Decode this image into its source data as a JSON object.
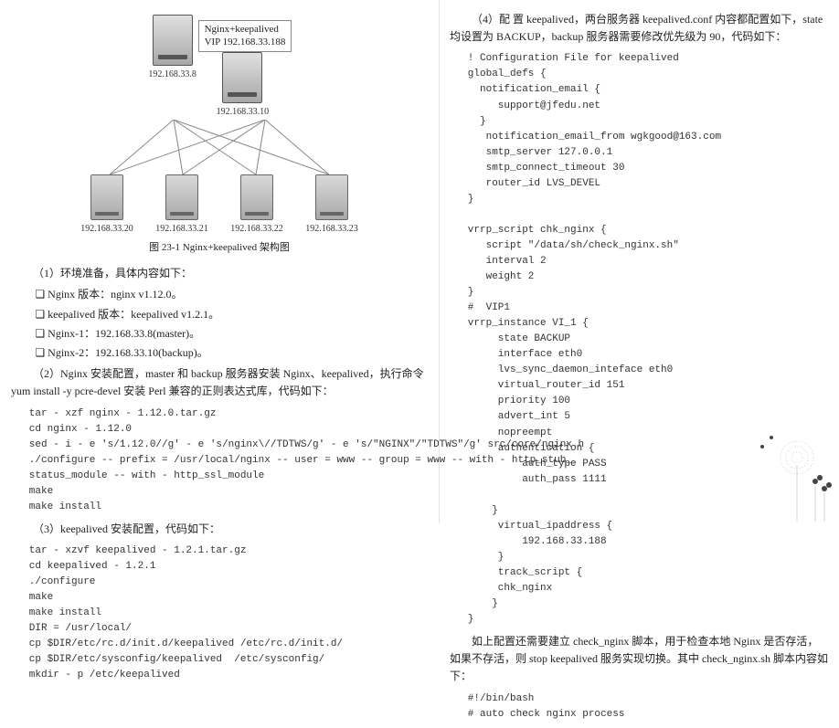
{
  "diagram": {
    "top_label_line1": "Nginx+keepalived",
    "top_label_line2": "VIP 192.168.33.188",
    "top_ip_left": "192.168.33.8",
    "top_ip_right": "192.168.33.10",
    "bottom_ips": [
      "192.168.33.20",
      "192.168.33.21",
      "192.168.33.22",
      "192.168.33.23"
    ],
    "caption": "图 23-1  Nginx+keepalived 架构图"
  },
  "left": {
    "p1": "（1）环境准备，具体内容如下：",
    "b1": "Nginx 版本：nginx v1.12.0。",
    "b2": "keepalived 版本：keepalived v1.2.1。",
    "b3": "Nginx-1：192.168.33.8(master)。",
    "b4": "Nginx-2：192.168.33.10(backup)。",
    "p2": "（2）Nginx 安装配置，master 和 backup 服务器安装 Nginx、keepalived，执行命令 yum install -y pcre-devel 安装 Perl 兼容的正则表达式库，代码如下：",
    "code1": "tar - xzf nginx - 1.12.0.tar.gz\ncd nginx - 1.12.0\nsed - i - e 's/1.12.0//g' - e 's/nginx\\//TDTWS/g' - e 's/\"NGINX\"/\"TDTWS\"/g' src/core/nginx.h\n./configure -- prefix = /usr/local/nginx -- user = www -- group = www -- with - http_stub_\nstatus_module -- with - http_ssl_module\nmake\nmake install",
    "p3": "（3）keepalived 安装配置，代码如下：",
    "code2": "tar - xzvf keepalived - 1.2.1.tar.gz\ncd keepalived - 1.2.1\n./configure\nmake\nmake install\nDIR = /usr/local/\ncp $DIR/etc/rc.d/init.d/keepalived /etc/rc.d/init.d/\ncp $DIR/etc/sysconfig/keepalived  /etc/sysconfig/\nmkdir - p /etc/keepalived"
  },
  "right": {
    "p1": "（4）配 置 keepalived，两台服务器 keepalived.conf 内容都配置如下，state 均设置为 BACKUP，backup 服务器需要修改优先级为 90，代码如下：",
    "code1": "! Configuration File for keepalived\nglobal_defs {\n  notification_email {\n     support@jfedu.net\n  }\n   notification_email_from wgkgood@163.com\n   smtp_server 127.0.0.1\n   smtp_connect_timeout 30\n   router_id LVS_DEVEL\n}\n\nvrrp_script chk_nginx {\n   script \"/data/sh/check_nginx.sh\"\n   interval 2\n   weight 2\n}\n#  VIP1\nvrrp_instance VI_1 {\n     state BACKUP\n     interface eth0\n     lvs_sync_daemon_inteface eth0\n     virtual_router_id 151\n     priority 100\n     advert_int 5\n     nopreempt\n     authentication {\n         auth_type PASS\n         auth_pass 1111\n\n    }\n     virtual_ipaddress {\n         192.168.33.188\n     }\n     track_script {\n     chk_nginx\n    }\n}",
    "p2": "如上配置还需要建立 check_nginx 脚本，用于检查本地 Nginx 是否存活，如果不存活，则 stop keepalived 服务实现切换。其中 check_nginx.sh 脚本内容如下：",
    "code2": "#!/bin/bash\n# auto check nginx process"
  }
}
